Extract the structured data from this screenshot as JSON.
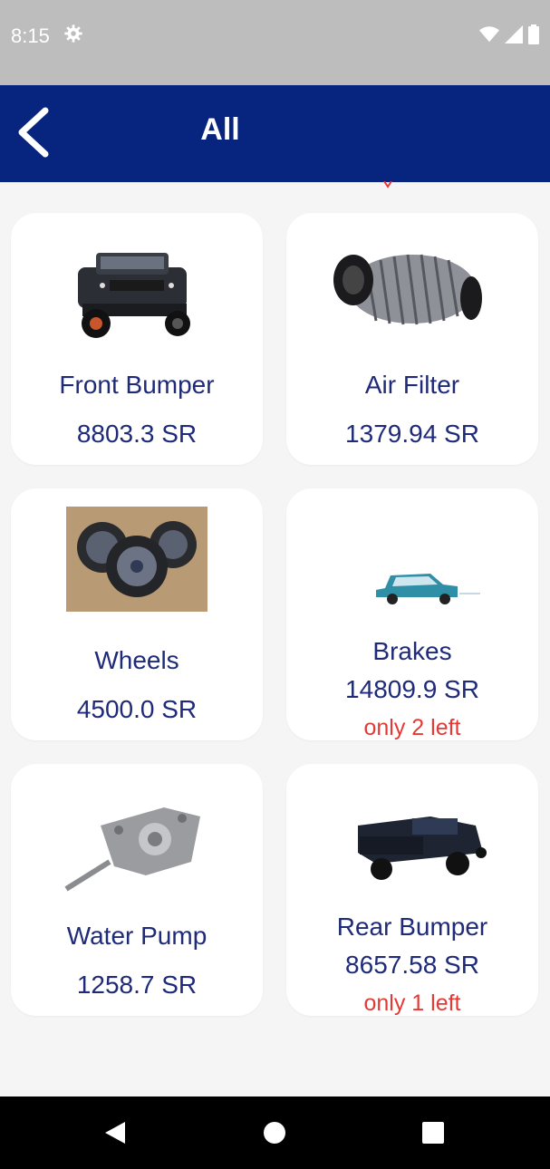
{
  "status_bar": {
    "time": "8:15"
  },
  "app_bar": {
    "title": "All"
  },
  "products": [
    {
      "name": "Front Bumper",
      "price": "8803.3 SR",
      "stock": "",
      "image": "truck-front-icon"
    },
    {
      "name": "Air Filter",
      "price": "1379.94 SR",
      "stock": "",
      "image": "air-filter-icon"
    },
    {
      "name": "Wheels",
      "price": "4500.0 SR",
      "stock": "",
      "image": "wheels-icon"
    },
    {
      "name": "Brakes",
      "price": "14809.9 SR",
      "stock": "only 2 left",
      "image": "car-icon"
    },
    {
      "name": "Water Pump",
      "price": "1258.7 SR",
      "stock": "",
      "image": "water-pump-icon"
    },
    {
      "name": "Rear Bumper",
      "price": "8657.58 SR",
      "stock": "only 1 left",
      "image": "truck-rear-icon"
    }
  ],
  "colors": {
    "app_bar": "#07247f",
    "text": "#1f2a78",
    "stock": "#e53935"
  }
}
